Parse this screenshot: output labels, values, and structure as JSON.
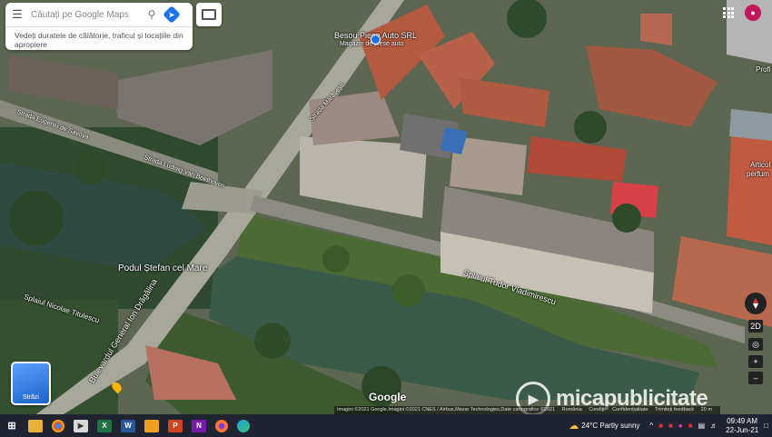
{
  "search": {
    "placeholder": "Căutați pe Google Maps",
    "hint": "Vedeți duratele de călătorie, traficul și locațiile din apropiere"
  },
  "map_labels": {
    "shop": "Besou Piese Auto SRL",
    "shop_sub": "Magazin de piese auto",
    "bridge": "Podul Ștefan cel Mare",
    "bvd": "Bulevardul General Ion Drăgălina",
    "splai_tudor": "Splaiul Tudor Vladimirescu",
    "splai_nicolae": "Splaiul Nicolae Titulescu",
    "street_top": "Strada Mărășești",
    "street_left": "Strada Eugeniu de Savoya",
    "street_mid": "Strada Ludwig Van Beethoven",
    "poi_right": "Articol",
    "poi_right2": "perfum",
    "poi_right3": "Profi"
  },
  "street_view": {
    "label": "Străzi"
  },
  "controls": {
    "mode": "2D",
    "zoom_in": "+",
    "zoom_out": "–"
  },
  "attribution": {
    "imagery": "Imagini ©2021 Google,Imagini ©2021 CNES / Airbus,Maxar Technologies,Date cartografice ©2021",
    "country": "România",
    "terms": "Condiții",
    "privacy": "Confidențialitate",
    "feedback": "Trimiteți feedback",
    "scale": "20 m"
  },
  "google_logo": "Google",
  "watermark": "micapublicitate",
  "taskbar": {
    "weather": "24°C  Partly sunny",
    "time": "09:49 AM",
    "date": "22-Jun-21"
  },
  "colors": {
    "accent": "#1a73e8",
    "water": "#3a5a4a"
  }
}
